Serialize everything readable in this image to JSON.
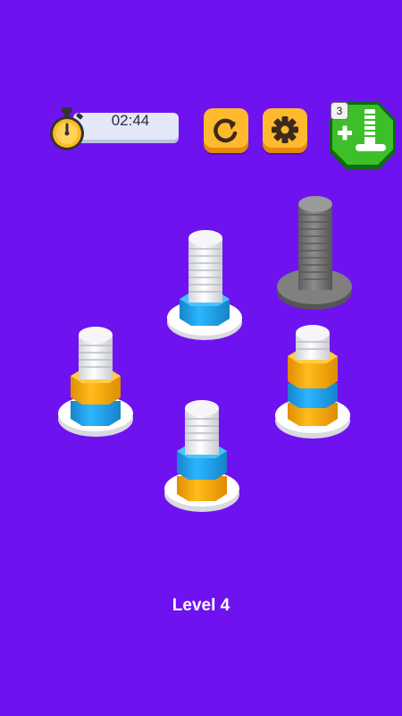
{
  "hud": {
    "timer_value": "02:44",
    "add_bolt_count": "3",
    "icons": {
      "timer": "stopwatch-icon",
      "restart": "restart-icon",
      "settings": "gear-icon",
      "add_bolt": "add-bolt-icon"
    }
  },
  "level_label": "Level 4",
  "colors": {
    "background": "#6f12f0",
    "blue": "#1fa8f0",
    "yellow": "#ffb10d",
    "white": "#f4f4f4",
    "gray": "#7a7a7a",
    "accent_button": "#ffb92e",
    "green_button": "#3dbf2a"
  },
  "bolts": [
    {
      "id": "top-center",
      "locked": false,
      "nuts_bottom_to_top": [
        "blue"
      ]
    },
    {
      "id": "gray-locked",
      "locked": true,
      "nuts_bottom_to_top": []
    },
    {
      "id": "left",
      "locked": false,
      "nuts_bottom_to_top": [
        "blue",
        "yellow"
      ]
    },
    {
      "id": "right",
      "locked": false,
      "nuts_bottom_to_top": [
        "yellow",
        "blue",
        "yellow"
      ]
    },
    {
      "id": "bottom-center",
      "locked": false,
      "nuts_bottom_to_top": [
        "yellow",
        "blue"
      ]
    }
  ]
}
